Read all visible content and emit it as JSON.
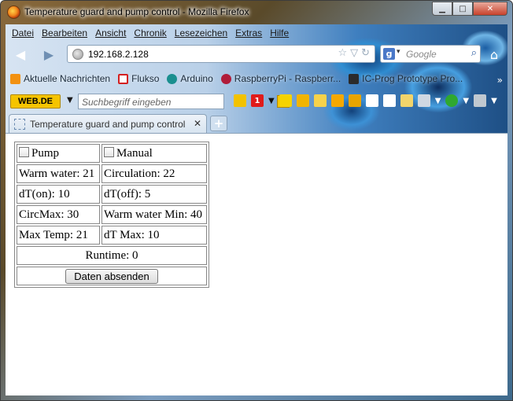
{
  "window": {
    "title": "Temperature guard and pump control - Mozilla Firefox",
    "controls": {
      "minimize": "▁",
      "maximize": "□",
      "close": "✕"
    }
  },
  "menubar": [
    "Datei",
    "Bearbeiten",
    "Ansicht",
    "Chronik",
    "Lesezeichen",
    "Extras",
    "Hilfe"
  ],
  "navigation": {
    "url": "192.168.2.128",
    "search_placeholder": "Google",
    "search_engine_letter": "g"
  },
  "bookmarks": [
    {
      "label": "Aktuelle Nachrichten",
      "icon": "rss-icon",
      "color": "#f29111"
    },
    {
      "label": "Flukso",
      "icon": "flukso-icon",
      "color": "#d42020"
    },
    {
      "label": "Arduino",
      "icon": "arduino-icon",
      "color": "#1a8f8f"
    },
    {
      "label": "RaspberryPi - Raspberr...",
      "icon": "raspberry-icon",
      "color": "#b01c3a"
    },
    {
      "label": "IC-Prog Prototype Pro...",
      "icon": "ic-prog-icon",
      "color": "#2b2b2b"
    }
  ],
  "toolbar2": {
    "brand": "WEB.DE",
    "search_placeholder": "Suchbegriff eingeben",
    "mail_count": "1"
  },
  "tab": {
    "label": "Temperature guard and pump control"
  },
  "form": {
    "pump_label": "Pump",
    "manual_label": "Manual",
    "rows": [
      [
        "Warm water: 21",
        "Circulation: 22"
      ],
      [
        "dT(on): 10",
        "dT(off): 5"
      ],
      [
        "CircMax: 30",
        "Warm water Min: 40"
      ],
      [
        "Max Temp: 21",
        "dT Max: 10"
      ]
    ],
    "runtime": "Runtime: 0",
    "submit_label": "Daten absenden"
  }
}
